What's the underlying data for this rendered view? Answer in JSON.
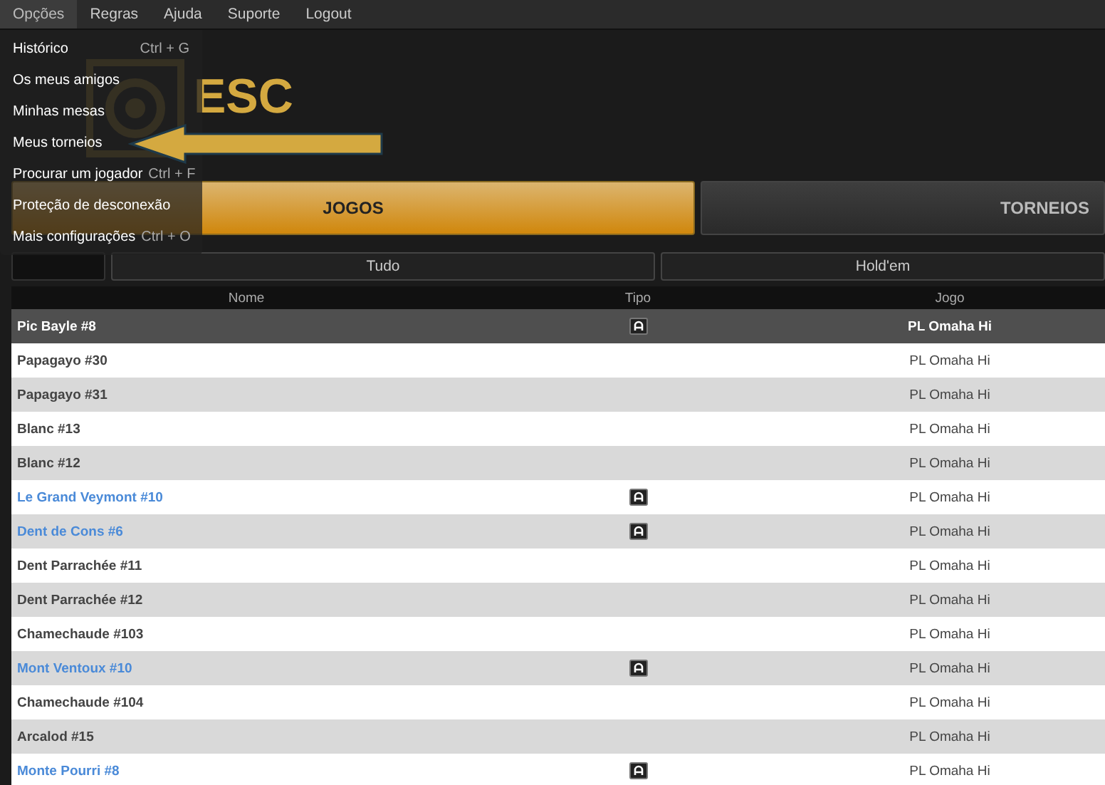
{
  "menubar": [
    {
      "label": "Opções",
      "selected": true
    },
    {
      "label": "Regras",
      "selected": false
    },
    {
      "label": "Ajuda",
      "selected": false
    },
    {
      "label": "Suporte",
      "selected": false
    },
    {
      "label": "Logout",
      "selected": false
    }
  ],
  "menu": [
    {
      "label": "Histórico",
      "shortcut": "Ctrl + G"
    },
    {
      "label": "Os meus amigos"
    },
    {
      "label": "Minhas mesas"
    },
    {
      "label": "Meus torneios"
    },
    {
      "label": "Procurar um jogador",
      "shortcut": "Ctrl + F"
    },
    {
      "label": "Proteção de desconexão"
    },
    {
      "label": "Mais configurações",
      "shortcut": "Ctrl + O"
    }
  ],
  "logo": {
    "text": "ESC"
  },
  "tabs": [
    {
      "label": "JOGOS",
      "selected": true
    },
    {
      "label": "TORNEIOS",
      "selected": false
    }
  ],
  "filters": [
    {
      "label": "Tudo"
    },
    {
      "label": "Hold'em"
    }
  ],
  "table": {
    "columns": [
      "Nome",
      "Tipo",
      "Jogo"
    ],
    "rows": [
      {
        "name": "Pic Bayle #8",
        "game": "PL Omaha Hi",
        "locked": true,
        "selected": true,
        "kind": "normal"
      },
      {
        "name": "Papagayo #30",
        "game": "PL Omaha Hi",
        "locked": false,
        "selected": false,
        "kind": "normal"
      },
      {
        "name": "Papagayo #31",
        "game": "PL Omaha Hi",
        "locked": false,
        "selected": false,
        "kind": "normal"
      },
      {
        "name": "Blanc #13",
        "game": "PL Omaha Hi",
        "locked": false,
        "selected": false,
        "kind": "normal"
      },
      {
        "name": "Blanc #12",
        "game": "PL Omaha Hi",
        "locked": false,
        "selected": false,
        "kind": "normal"
      },
      {
        "name": "Le Grand Veymont #10",
        "game": "PL Omaha Hi",
        "locked": true,
        "selected": false,
        "kind": "featured"
      },
      {
        "name": "Dent de Cons #6",
        "game": "PL Omaha Hi",
        "locked": true,
        "selected": false,
        "kind": "featured"
      },
      {
        "name": "Dent Parrachée #11",
        "game": "PL Omaha Hi",
        "locked": false,
        "selected": false,
        "kind": "normal"
      },
      {
        "name": "Dent Parrachée #12",
        "game": "PL Omaha Hi",
        "locked": false,
        "selected": false,
        "kind": "normal"
      },
      {
        "name": "Chamechaude #103",
        "game": "PL Omaha Hi",
        "locked": false,
        "selected": false,
        "kind": "normal"
      },
      {
        "name": "Mont Ventoux #10",
        "game": "PL Omaha Hi",
        "locked": true,
        "selected": false,
        "kind": "featured"
      },
      {
        "name": "Chamechaude #104",
        "game": "PL Omaha Hi",
        "locked": false,
        "selected": false,
        "kind": "normal"
      },
      {
        "name": "Arcalod #15",
        "game": "PL Omaha Hi",
        "locked": false,
        "selected": false,
        "kind": "normal"
      },
      {
        "name": "Monte Pourri #8",
        "game": "PL Omaha Hi",
        "locked": true,
        "selected": false,
        "kind": "featured"
      }
    ]
  }
}
